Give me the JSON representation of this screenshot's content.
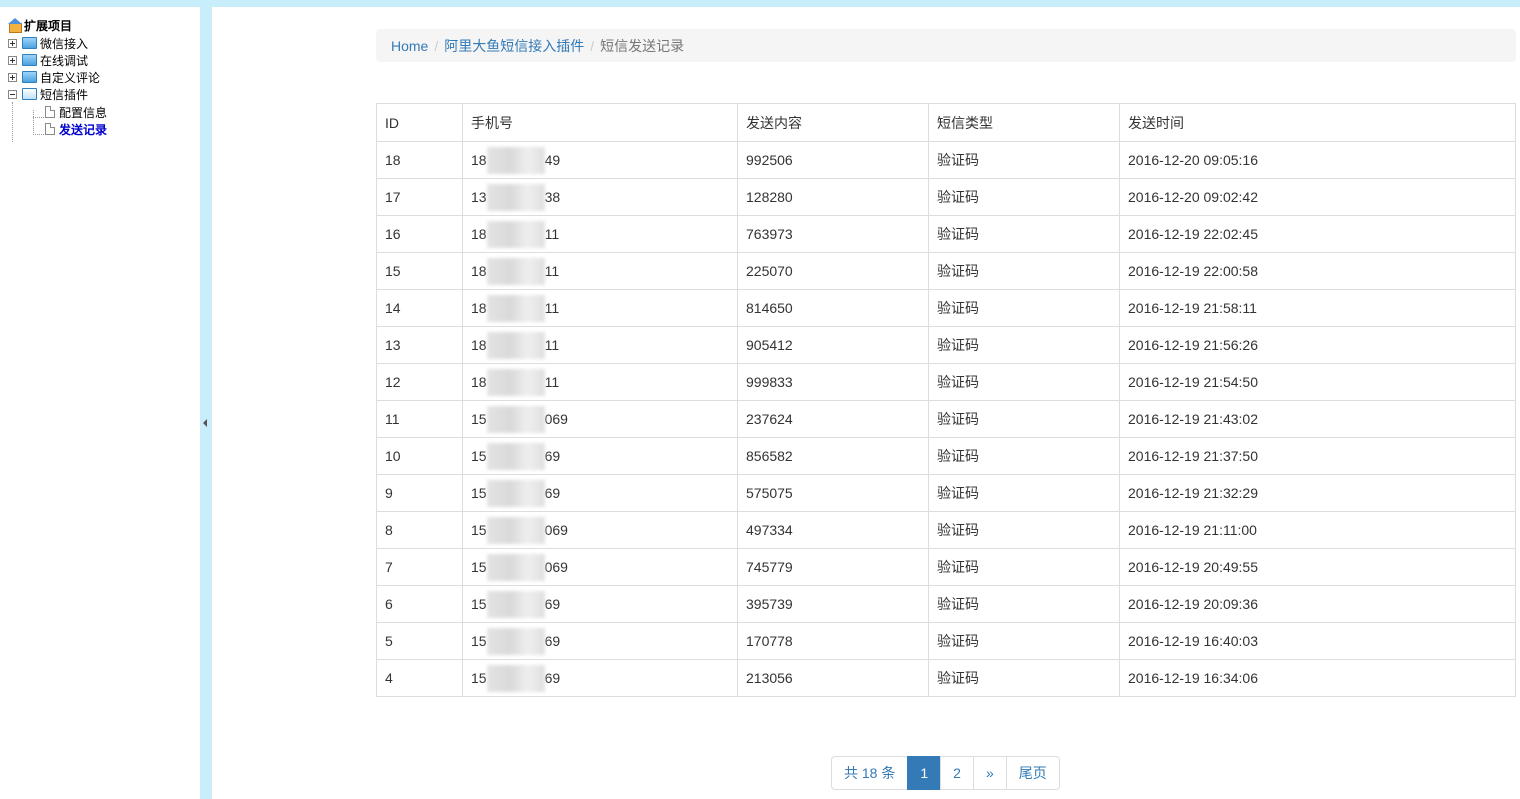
{
  "tree": {
    "root_label": "扩展项目",
    "nodes": [
      {
        "label": "微信接入"
      },
      {
        "label": "在线调试"
      },
      {
        "label": "自定义评论"
      },
      {
        "label": "短信插件"
      }
    ],
    "children": [
      {
        "label": "配置信息"
      },
      {
        "label": "发送记录"
      }
    ]
  },
  "breadcrumb": {
    "home": "Home",
    "plugin": "阿里大鱼短信接入插件",
    "current": "短信发送记录",
    "separator": "/"
  },
  "table": {
    "headers": [
      "ID",
      "手机号",
      "发送内容",
      "短信类型",
      "发送时间"
    ],
    "rows": [
      {
        "id": "18",
        "phone_prefix": "18",
        "phone_suffix": "49",
        "content": "992506",
        "type": "验证码",
        "time": "2016-12-20 09:05:16"
      },
      {
        "id": "17",
        "phone_prefix": "13",
        "phone_suffix": "38",
        "content": "128280",
        "type": "验证码",
        "time": "2016-12-20 09:02:42"
      },
      {
        "id": "16",
        "phone_prefix": "18",
        "phone_suffix": "11",
        "content": "763973",
        "type": "验证码",
        "time": "2016-12-19 22:02:45"
      },
      {
        "id": "15",
        "phone_prefix": "18",
        "phone_suffix": "11",
        "content": "225070",
        "type": "验证码",
        "time": "2016-12-19 22:00:58"
      },
      {
        "id": "14",
        "phone_prefix": "18",
        "phone_suffix": "11",
        "content": "814650",
        "type": "验证码",
        "time": "2016-12-19 21:58:11"
      },
      {
        "id": "13",
        "phone_prefix": "18",
        "phone_suffix": "11",
        "content": "905412",
        "type": "验证码",
        "time": "2016-12-19 21:56:26"
      },
      {
        "id": "12",
        "phone_prefix": "18",
        "phone_suffix": "11",
        "content": "999833",
        "type": "验证码",
        "time": "2016-12-19 21:54:50"
      },
      {
        "id": "11",
        "phone_prefix": "15",
        "phone_suffix": "069",
        "content": "237624",
        "type": "验证码",
        "time": "2016-12-19 21:43:02"
      },
      {
        "id": "10",
        "phone_prefix": "15",
        "phone_suffix": "69",
        "content": "856582",
        "type": "验证码",
        "time": "2016-12-19 21:37:50"
      },
      {
        "id": "9",
        "phone_prefix": "15",
        "phone_suffix": "69",
        "content": "575075",
        "type": "验证码",
        "time": "2016-12-19 21:32:29"
      },
      {
        "id": "8",
        "phone_prefix": "15",
        "phone_suffix": "069",
        "content": "497334",
        "type": "验证码",
        "time": "2016-12-19 21:11:00"
      },
      {
        "id": "7",
        "phone_prefix": "15",
        "phone_suffix": "069",
        "content": "745779",
        "type": "验证码",
        "time": "2016-12-19 20:49:55"
      },
      {
        "id": "6",
        "phone_prefix": "15",
        "phone_suffix": "69",
        "content": "395739",
        "type": "验证码",
        "time": "2016-12-19 20:09:36"
      },
      {
        "id": "5",
        "phone_prefix": "15",
        "phone_suffix": "69",
        "content": "170778",
        "type": "验证码",
        "time": "2016-12-19 16:40:03"
      },
      {
        "id": "4",
        "phone_prefix": "15",
        "phone_suffix": "69",
        "content": "213056",
        "type": "验证码",
        "time": "2016-12-19 16:34:06"
      }
    ]
  },
  "pagination": {
    "total": "共 18 条",
    "pages": [
      "1",
      "2"
    ],
    "active_page": "1",
    "next": "»",
    "last": "尾页"
  },
  "colors": {
    "accent": "#337ab7",
    "sidebar_bg": "#c9eefb",
    "active_tree": "#0000cc"
  }
}
